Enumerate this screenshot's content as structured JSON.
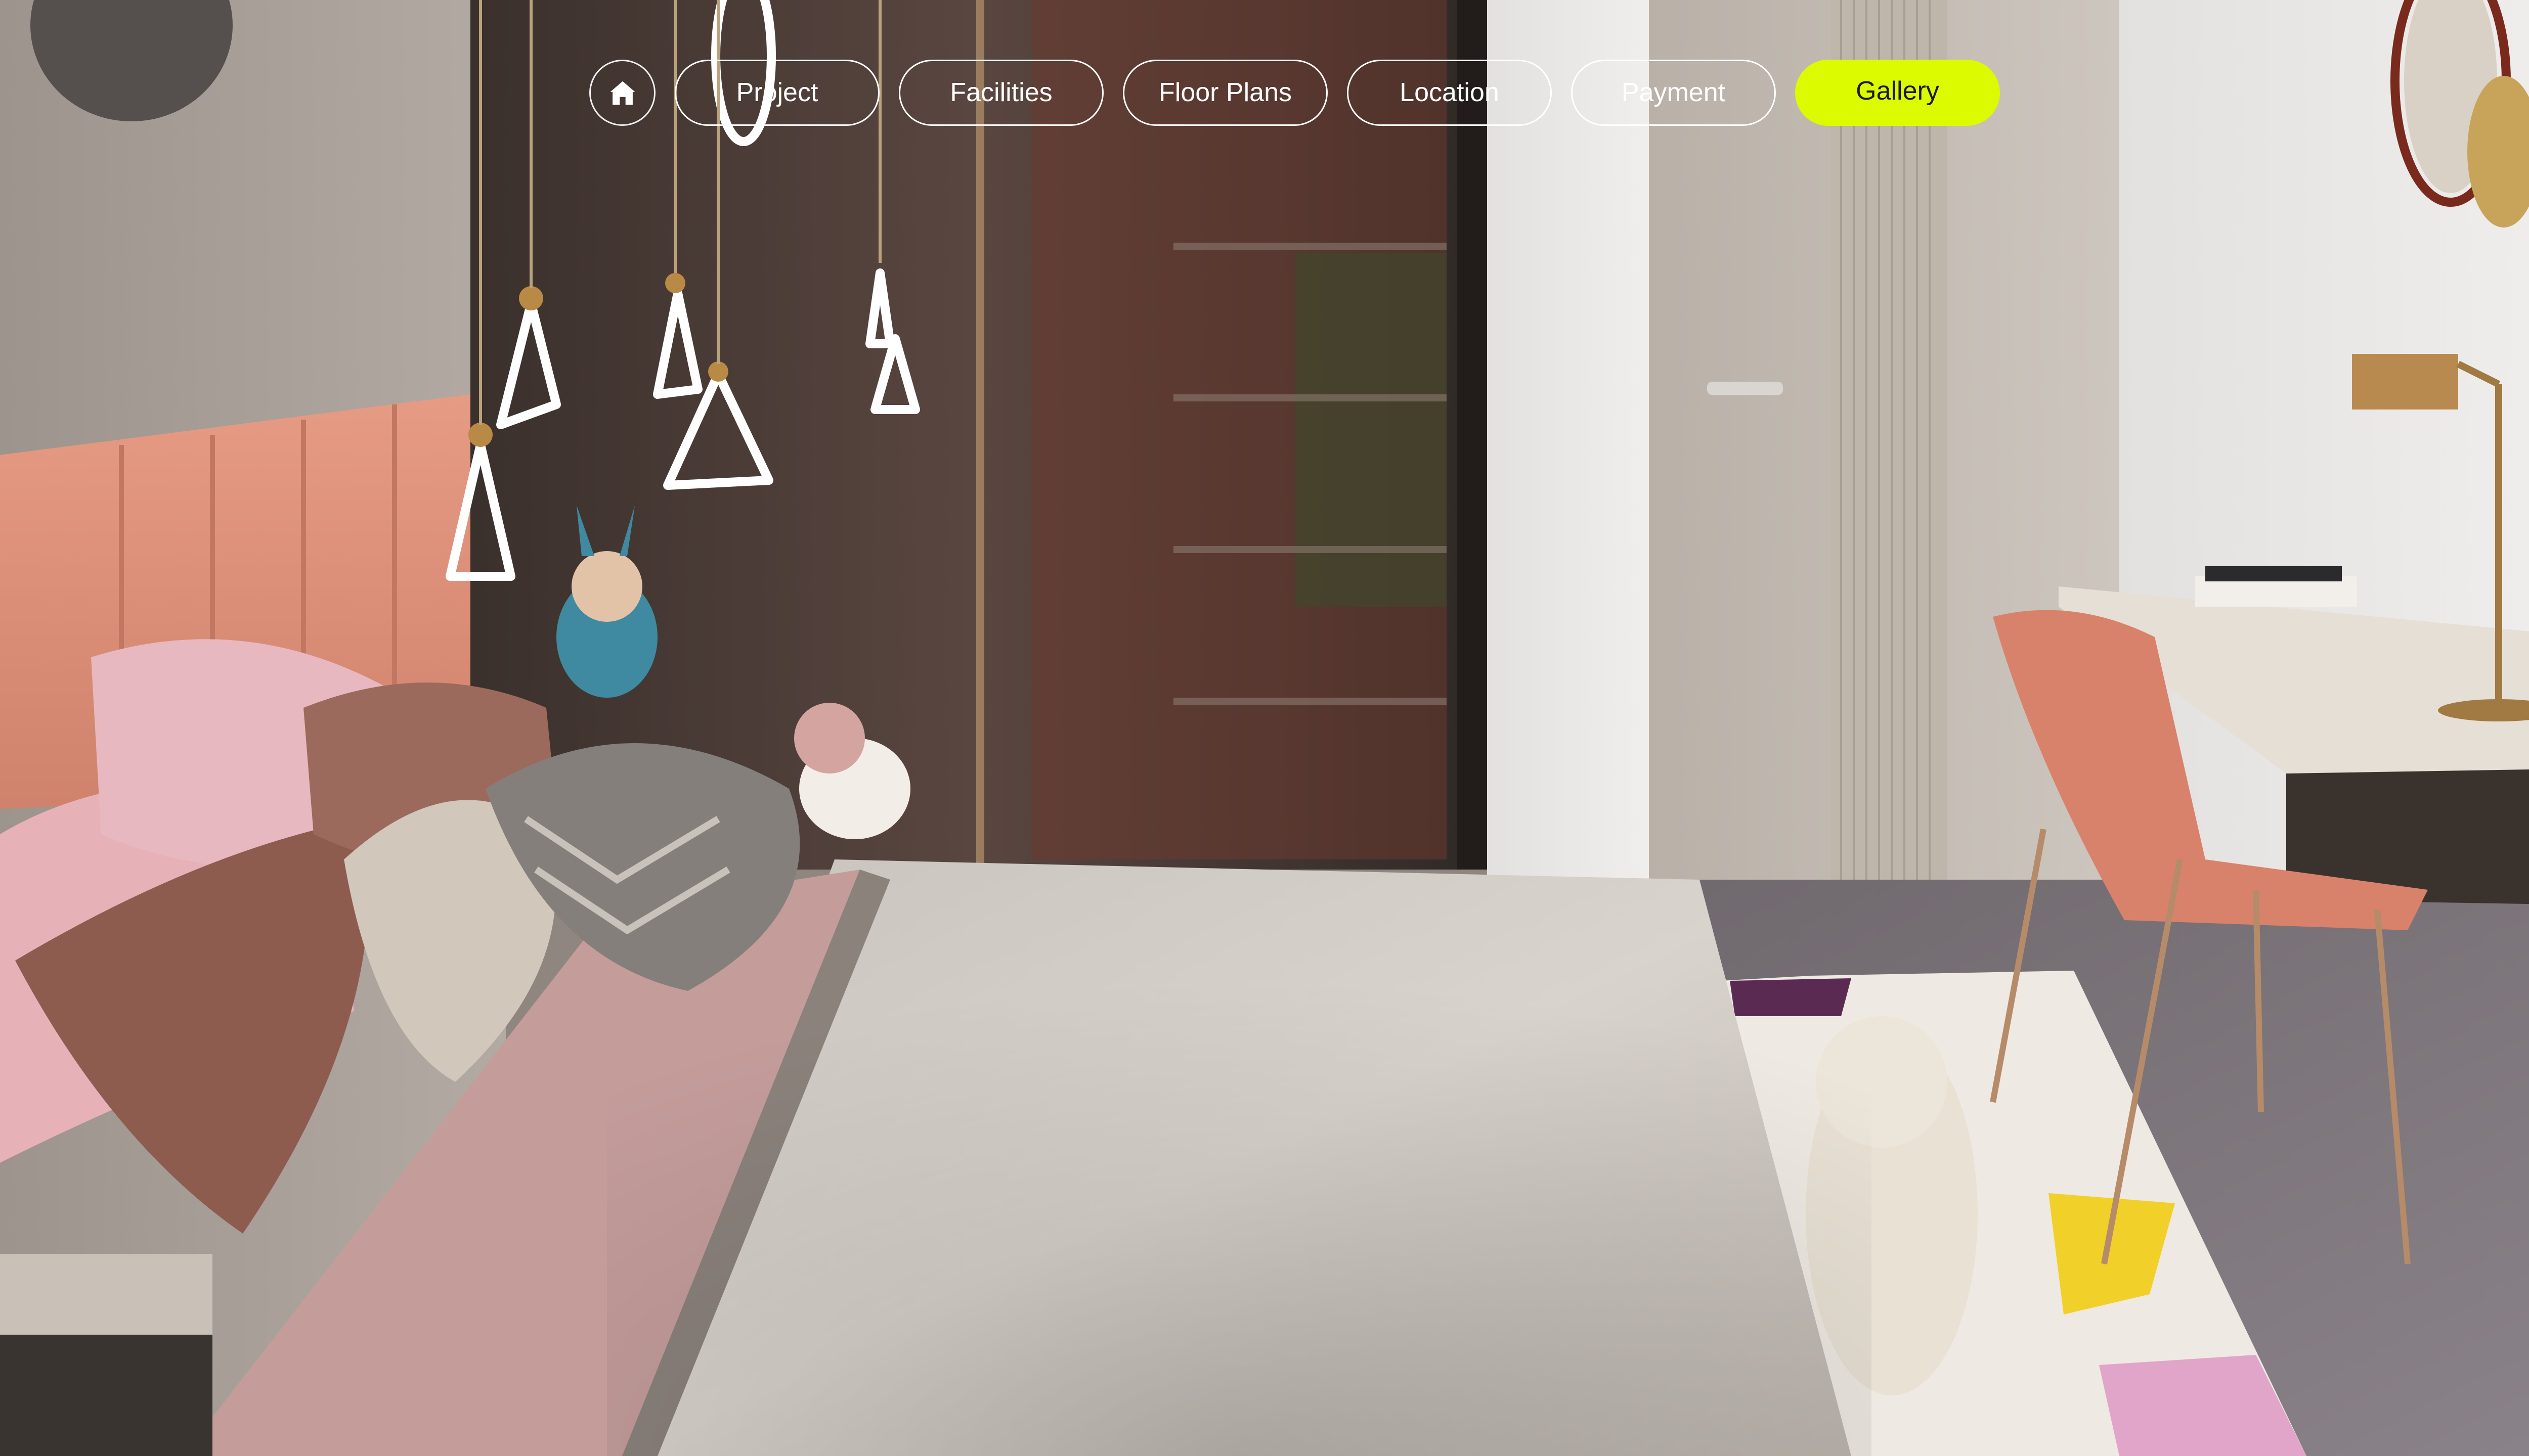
{
  "nav": {
    "home_icon": "home-icon",
    "items": [
      {
        "label": "Project",
        "active": false
      },
      {
        "label": "Facilities",
        "active": false
      },
      {
        "label": "Floor Plans",
        "active": false
      },
      {
        "label": "Location",
        "active": false
      },
      {
        "label": "Payment",
        "active": false
      },
      {
        "label": "Gallery",
        "active": true
      }
    ]
  },
  "colors": {
    "accent": "#dcfa00",
    "pill_border": "#ffffff",
    "pill_text": "#ffffff",
    "active_text": "#1a1a1a"
  }
}
